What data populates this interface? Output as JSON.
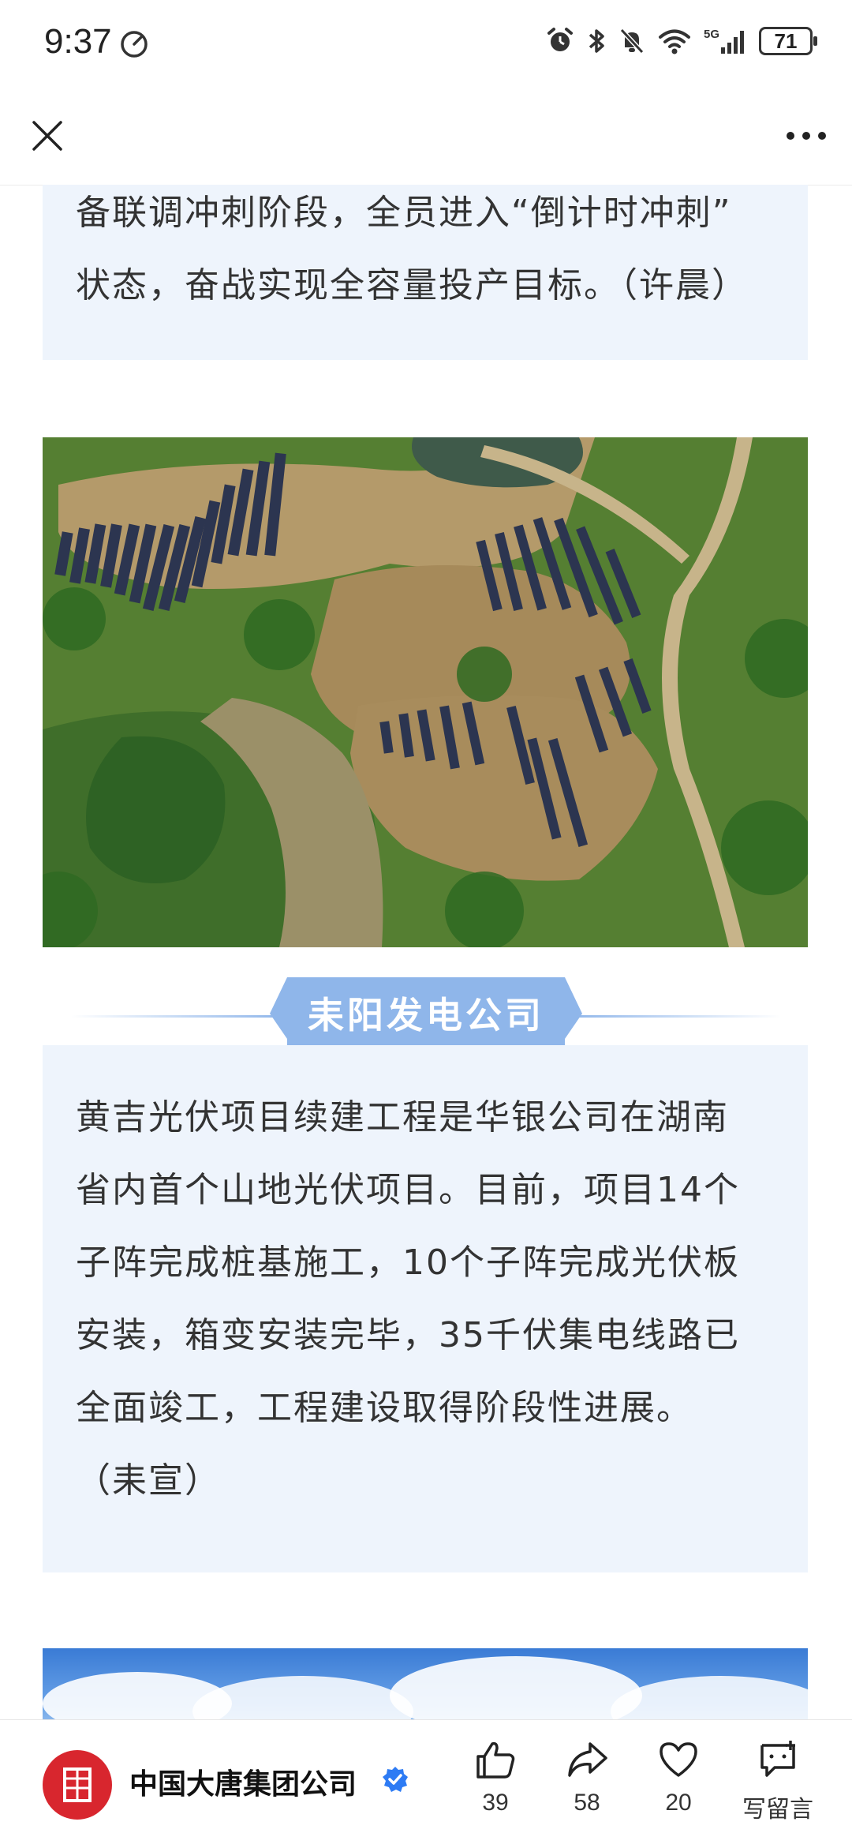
{
  "status_bar": {
    "time": "9:37",
    "battery": "71",
    "network": "5G",
    "icons": [
      "speedometer-icon",
      "alarm-icon",
      "bluetooth-icon",
      "mute-icon",
      "wifi-icon",
      "signal-icon",
      "battery-icon"
    ]
  },
  "nav": {
    "close_icon": "close-icon",
    "more_icon": "more-icon"
  },
  "article": {
    "block1_lines": [
      "备联调冲刺阶段，全员进入“倒计时冲刺”",
      "状态，奋战实现全容量投产目标。（许晨）"
    ],
    "section_title": "耒阳发电公司",
    "block2_lines": [
      "黄吉光伏项目续建工程是华银公司在湖南",
      "省内首个山地光伏项目。目前，项目14个",
      "子阵完成桩基施工，10个子阵完成光伏板",
      "安装，箱变安装完毕，35千伏集电线路已",
      "全面竣工，工程建设取得阶段性进展。",
      "（耒宣）"
    ]
  },
  "bottom_bar": {
    "account_name": "中国大唐集团公司",
    "like_count": "39",
    "share_count": "58",
    "favorite_count": "20",
    "comment_label": "写留言"
  },
  "colors": {
    "accent_blue": "#8fb6ea",
    "box_bg": "#eef4fc",
    "brand_red": "#d8262e",
    "verified_blue": "#2d7bf4"
  }
}
